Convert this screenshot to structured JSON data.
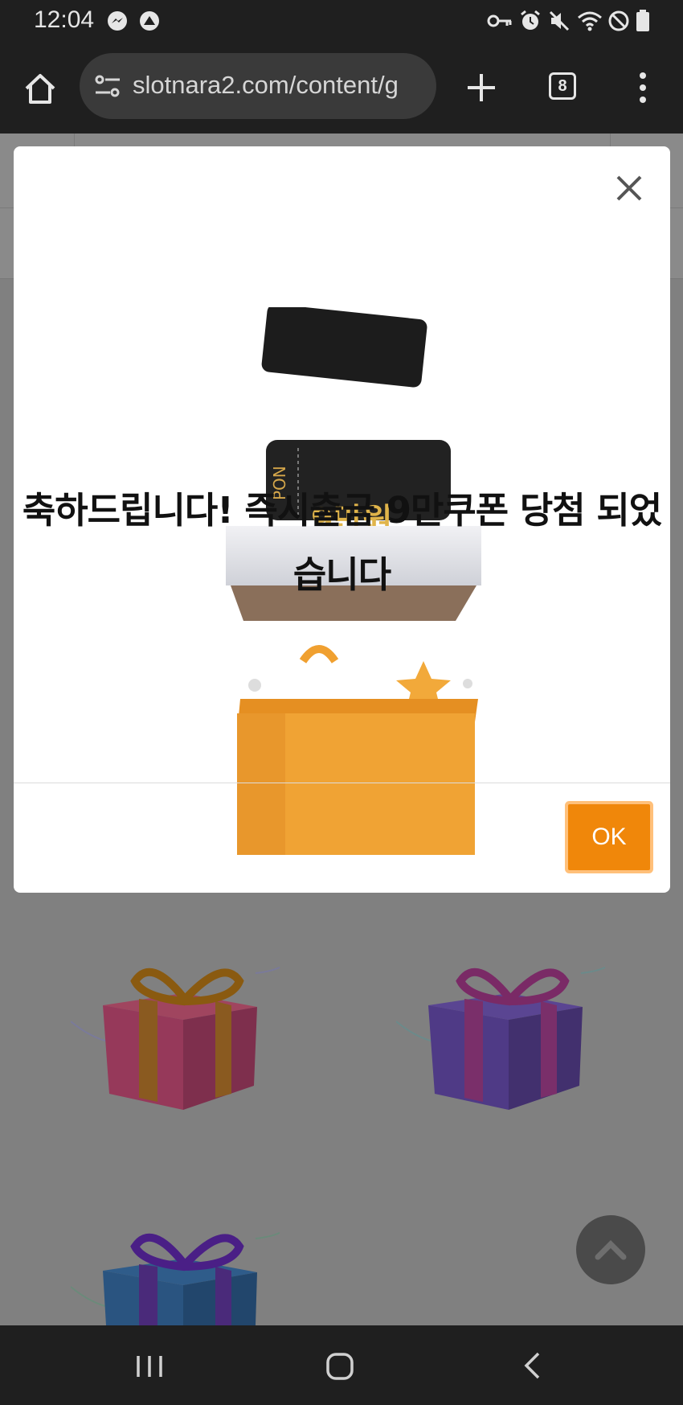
{
  "status_bar": {
    "time": "12:04",
    "left_icons": [
      "messenger-icon",
      "app-notification-icon"
    ],
    "right_icons": [
      "vpn-key-icon",
      "alarm-icon",
      "mute-icon",
      "wifi-icon",
      "do-not-disturb-icon",
      "battery-icon"
    ]
  },
  "browser": {
    "url": "slotnara2.com/content/g",
    "tab_count": "8"
  },
  "modal": {
    "coupon_label": "PON",
    "coupon_amount": "9만원",
    "message": "축하드립니다! 즉시출금 9만쿠폰 당첨 되었습니다",
    "ok_label": "OK"
  },
  "colors": {
    "accent": "#f0870a",
    "overlay": "#808080",
    "system_bar": "#1f1f1f"
  }
}
